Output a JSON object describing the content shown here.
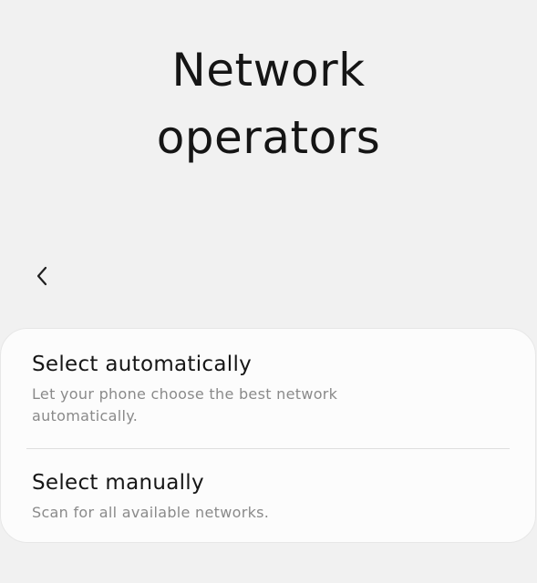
{
  "header": {
    "title_line1": "Network",
    "title_line2": "operators"
  },
  "navigation": {
    "back_icon": "chevron-left-icon"
  },
  "options": [
    {
      "title": "Select automatically",
      "description": "Let your phone choose the best network automatically."
    },
    {
      "title": "Select manually",
      "description": "Scan for all available networks."
    }
  ],
  "colors": {
    "background": "#f1f1f1",
    "card": "#fcfcfc",
    "title_text": "#161616",
    "description_text": "#8a8a8a",
    "divider": "#dedede"
  }
}
